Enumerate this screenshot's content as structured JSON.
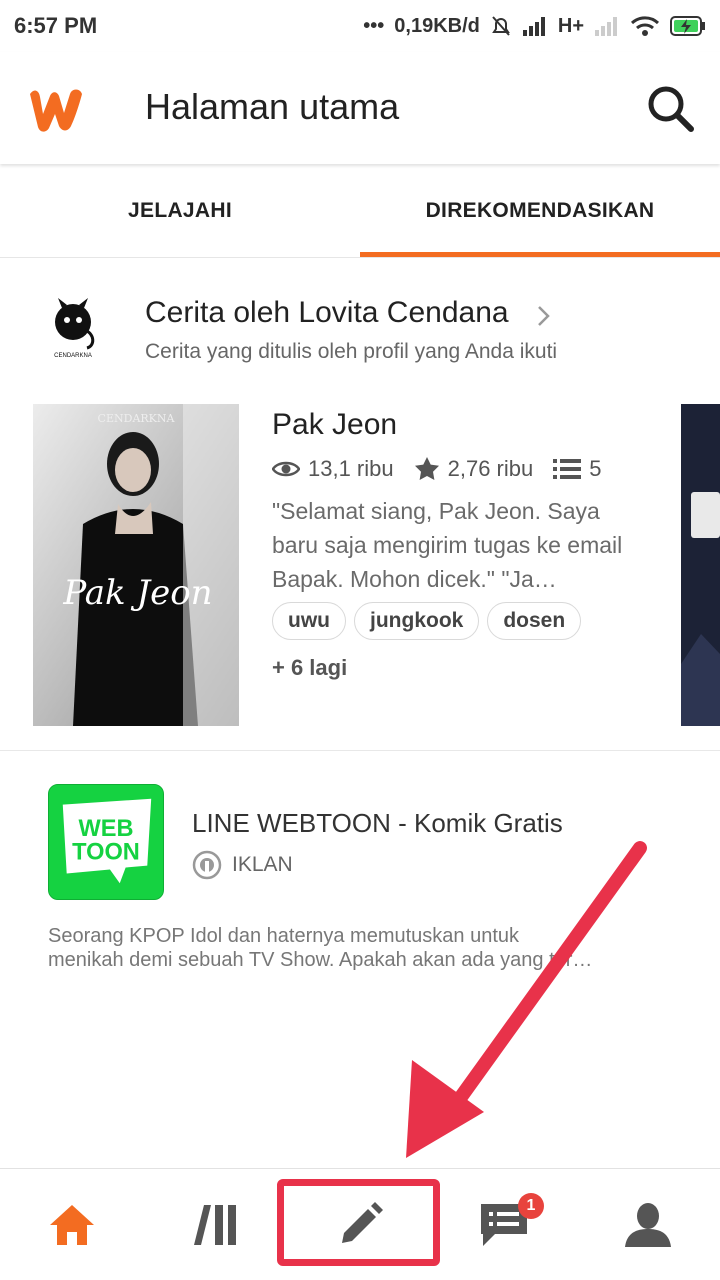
{
  "status_bar": {
    "time": "6:57 PM",
    "data_rate": "0,19KB/d",
    "network": "H+"
  },
  "app_bar": {
    "title": "Halaman utama"
  },
  "tabs": [
    {
      "label": "JELAJAHI",
      "active": false
    },
    {
      "label": "DIREKOMENDASIKAN",
      "active": true
    }
  ],
  "section": {
    "title": "Cerita oleh Lovita Cendana",
    "subtitle": "Cerita yang ditulis oleh profil yang Anda ikuti",
    "avatar_caption": "CENDARKNA"
  },
  "story": {
    "title": "Pak Jeon",
    "cover_text": "Pak Jeon",
    "cover_brand": "CENDARKNA",
    "reads": "13,1 ribu",
    "votes": "2,76 ribu",
    "parts": "5",
    "description": "\"Selamat siang, Pak Jeon. Saya baru saja mengirim tugas ke email Bapak. Mohon dicek.\" \"Ja…",
    "tags": [
      "uwu",
      "jungkook",
      "dosen"
    ],
    "more_tags": "+ 6 lagi"
  },
  "ad": {
    "title": "LINE WEBTOON - Komik Gratis",
    "label": "IKLAN",
    "icon_line1": "WEB",
    "icon_line2": "TOON",
    "desc_line1": "Seorang KPOP Idol dan haternya memutuskan untuk",
    "desc_line2": "menikah demi sebuah TV Show. Apakah akan ada yang ter…"
  },
  "bottom_nav": {
    "items": [
      "home-icon",
      "library-icon",
      "write-icon",
      "notifications-icon",
      "profile-icon"
    ],
    "notification_count": "1"
  },
  "colors": {
    "brand": "#f36c21",
    "annotation": "#e8324a",
    "badge": "#e8433d"
  }
}
